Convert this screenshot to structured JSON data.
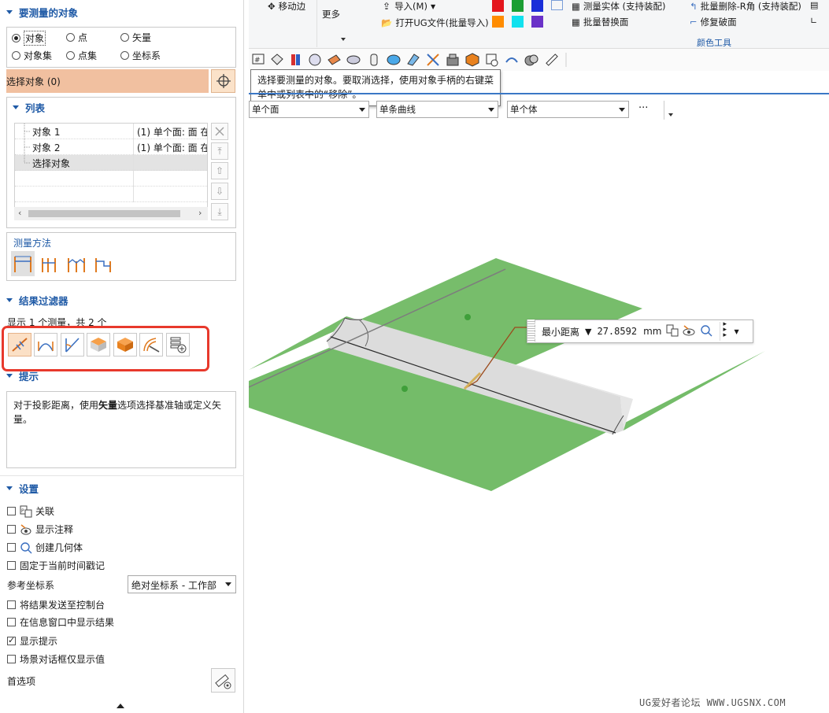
{
  "panel": {
    "objects_section": {
      "title": "要测量的对象",
      "radios": [
        {
          "label": "对象",
          "selected": true
        },
        {
          "label": "点",
          "selected": false
        },
        {
          "label": "矢量",
          "selected": false
        },
        {
          "label": "对象集",
          "selected": false
        },
        {
          "label": "点集",
          "selected": false
        },
        {
          "label": "坐标系",
          "selected": false
        }
      ],
      "select_label": "选择对象 (0)"
    },
    "list_section": {
      "title": "列表",
      "rows": [
        {
          "name": "对象 1",
          "value": "(1) 单个面: 面 在"
        },
        {
          "name": "对象 2",
          "value": "(1) 单个面: 面 在"
        },
        {
          "name": "选择对象",
          "value": ""
        }
      ]
    },
    "method_section": {
      "title": "测量方法"
    },
    "filter_section": {
      "title": "结果过滤器",
      "summary": "显示 1 个测量，共 2 个"
    },
    "hint_section": {
      "title": "提示",
      "text_before": "对于投影距离，使用",
      "text_bold": "矢量",
      "text_after": "选项选择基准轴或定义矢量。"
    },
    "settings_section": {
      "title": "设置",
      "options": [
        {
          "label": "关联",
          "checked": false,
          "icon": "associative-icon"
        },
        {
          "label": "显示注释",
          "checked": false,
          "icon": "show-annotation-icon"
        },
        {
          "label": "创建几何体",
          "checked": false,
          "icon": "create-geometry-icon"
        },
        {
          "label": "固定于当前时间戳记",
          "checked": false
        },
        {
          "label": "将结果发送至控制台",
          "checked": false
        },
        {
          "label": "在信息窗口中显示结果",
          "checked": false
        },
        {
          "label": "显示提示",
          "checked": true
        },
        {
          "label": "场景对话框仅显示值",
          "checked": false
        }
      ],
      "ref_csys_label": "参考坐标系",
      "ref_csys_value": "绝对坐标系 - 工作部",
      "preferences_label": "首选项"
    }
  },
  "ribbon": {
    "move_edge": "移动边",
    "more": "更多",
    "import": "导入(M)",
    "open_ug": "打开UG文件(批量导入)",
    "measure_solid": "测量实体 (支持装配)",
    "batch_replace": "批量替换面",
    "batch_delete_r": "批量删除-R角 (支持装配)",
    "repair_face": "修复破面",
    "color_tools": "颜色工具",
    "swatches": [
      "#e4161d",
      "#1b9e33",
      "#1a2fd9",
      "#ff8c00",
      "#11e1ee",
      "#6a32c8"
    ]
  },
  "tooltip": {
    "line1": "选择要测量的对象。要取消选择，使用对象手柄的右键菜",
    "line2": "单中或列表中的“移除”。"
  },
  "filters_bar": {
    "face_rule": "单个面",
    "curve_rule": "单条曲线",
    "body_rule": "单个体",
    "more": "···"
  },
  "readout": {
    "type": "最小距离",
    "value": "27.8592",
    "unit": "mm"
  },
  "watermark": "UG爱好者论坛 WWW.UGSNX.COM"
}
